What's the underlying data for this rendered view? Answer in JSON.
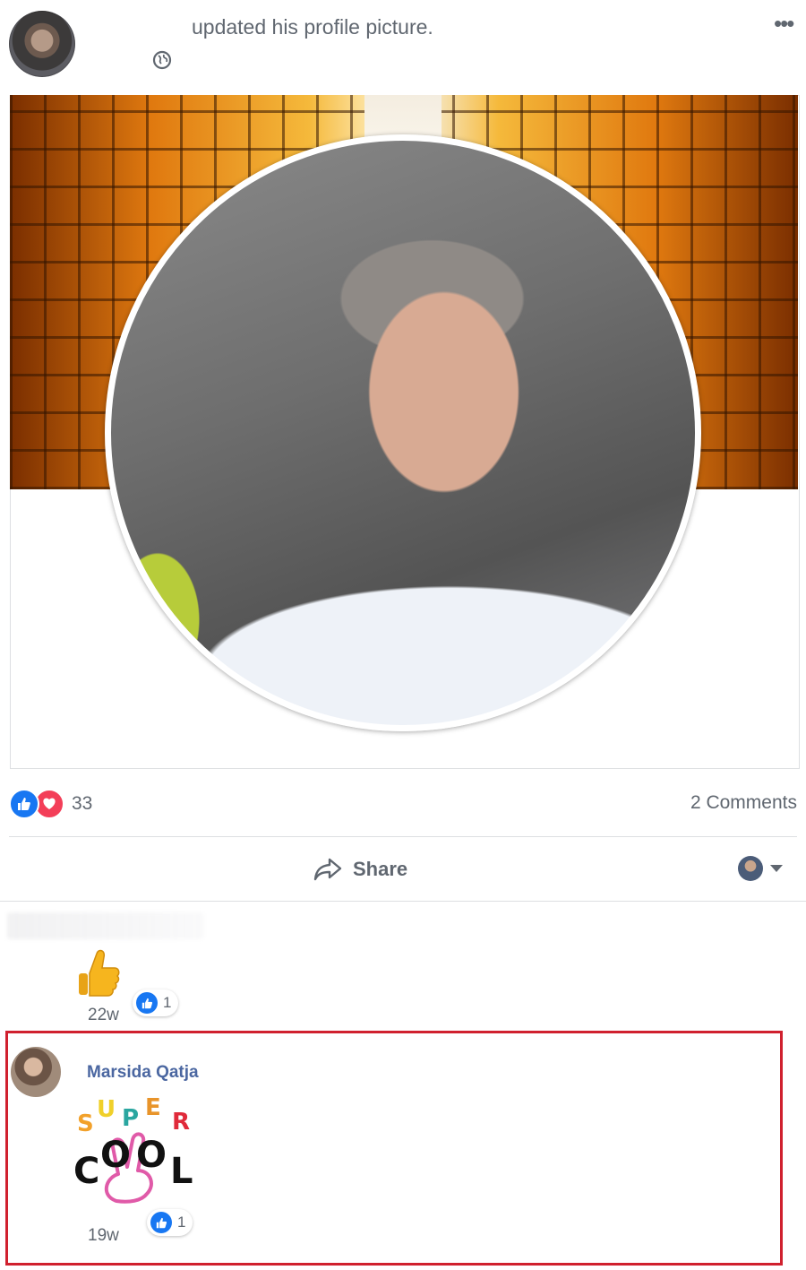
{
  "post": {
    "headline": "updated his profile picture.",
    "privacy_icon": "globe-icon",
    "menu_icon": "more-icon",
    "menu_glyph": "•••"
  },
  "reactions": {
    "types": [
      "like",
      "love"
    ],
    "count": "33",
    "comments_label": "2 Comments"
  },
  "actions": {
    "share_label": "Share"
  },
  "comments": [
    {
      "content": "thumbs-up emoji",
      "time": "22w",
      "likes": "1"
    },
    {
      "author": "Marsida Qatja",
      "sticker_text": [
        "S",
        "U",
        "P",
        "E",
        "R",
        "C",
        "O",
        "O",
        "L"
      ],
      "time": "19w",
      "likes": "1"
    }
  ],
  "colors": {
    "like": "#1877f2",
    "love": "#f33e58",
    "link": "#4b67a1",
    "highlight": "#d0202e",
    "secondary_text": "#606770"
  }
}
